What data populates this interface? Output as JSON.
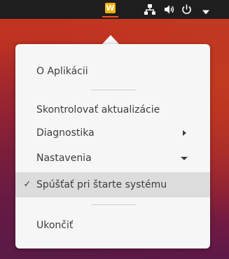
{
  "top_bar": {
    "tray_app_letter": "W",
    "icons": [
      "network-icon",
      "volume-icon",
      "power-icon",
      "chevron-down-icon"
    ],
    "accent_color": "#e95420",
    "tray_color": "#f3b100"
  },
  "menu": {
    "about": "O Aplikácii",
    "check_updates": "Skontrolovať aktualizácie",
    "diagnostics": "Diagnostika",
    "settings": "Nastavenia",
    "autostart": "Spúšťať pri štarte systému",
    "autostart_checked": true,
    "check_glyph": "✓",
    "quit": "Ukončiť"
  }
}
